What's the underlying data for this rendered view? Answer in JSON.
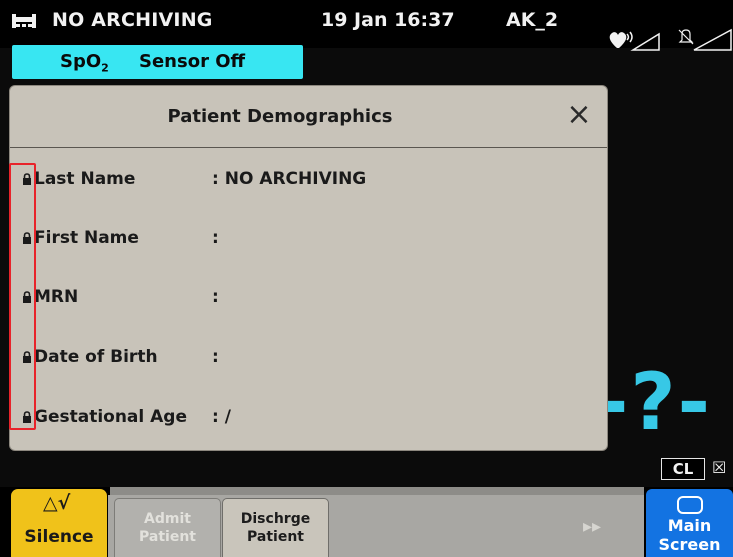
{
  "status_bar": {
    "bed_icon": "bed-icon",
    "patient_name": "NO ARCHIVING",
    "datetime": "19 Jan 16:37",
    "unit": "AK_2",
    "hr_icon": "heart-volume-icon",
    "alarm_icon": "alarm-off-icon"
  },
  "spo2_alert": {
    "label": "SpO",
    "subscript": "2",
    "status": "Sensor Off",
    "color": "#38e6f2"
  },
  "spo2_value": "-?-",
  "badges": {
    "cl": "CL",
    "mute": "☒"
  },
  "dialog": {
    "title": "Patient Demographics",
    "close_label": "×",
    "fields": [
      {
        "label": "Last Name",
        "value": ": NO ARCHIVING",
        "locked": true
      },
      {
        "label": "First Name",
        "value": ":",
        "locked": true
      },
      {
        "label": "MRN",
        "value": ":",
        "locked": true
      },
      {
        "label": "Date of Birth",
        "value": ":",
        "locked": true
      },
      {
        "label": "Gestational Age",
        "value": ":  /",
        "locked": true
      }
    ],
    "highlight_color": "#e8232a"
  },
  "bottom_bar": {
    "silence": {
      "icon": "△√",
      "label": "Silence",
      "color": "#f0c21a"
    },
    "admit": {
      "line1": "Admit",
      "line2": "Patient",
      "enabled": false
    },
    "discharge": {
      "line1": "Dischrge",
      "line2": "Patient",
      "enabled": true
    },
    "more": "▸▸",
    "main_screen": {
      "line1": "Main",
      "line2": "Screen",
      "color": "#1373e2"
    }
  }
}
